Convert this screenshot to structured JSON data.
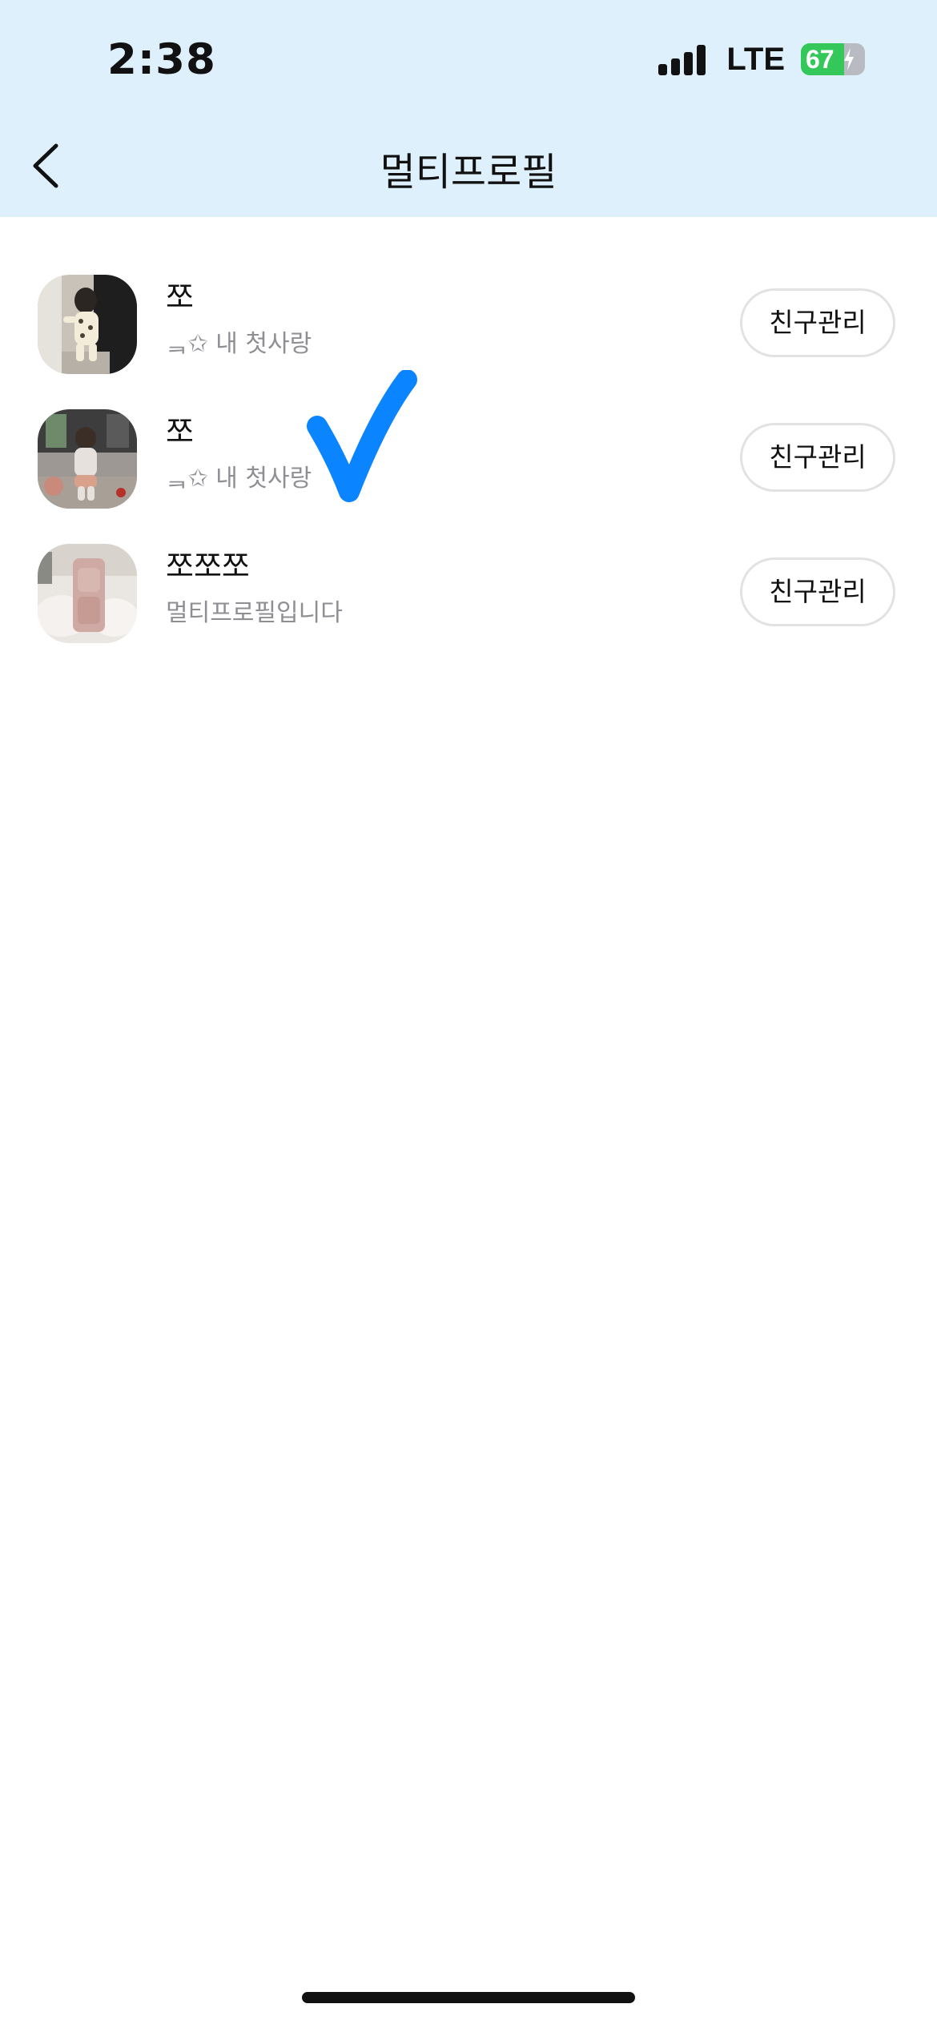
{
  "status_bar": {
    "time": "2:38",
    "network": "LTE",
    "battery": "67",
    "battery_level": 0.67,
    "battery_charging": true
  },
  "header": {
    "title": "멀티프로필"
  },
  "profiles": [
    {
      "name": "쪼",
      "status": "ᆿ✩ 내 첫사랑",
      "button": "친구관리"
    },
    {
      "name": "쪼",
      "status": "ᆿ✩ 내 첫사랑",
      "button": "친구관리"
    },
    {
      "name": "쪼쪼쪼",
      "status": "멀티프로필입니다",
      "button": "친구관리"
    }
  ],
  "colors": {
    "header_bg": "#dff0fd",
    "checkmark": "#0a84ff",
    "battery_green": "#34c759",
    "secondary_text": "#8e8e93"
  }
}
